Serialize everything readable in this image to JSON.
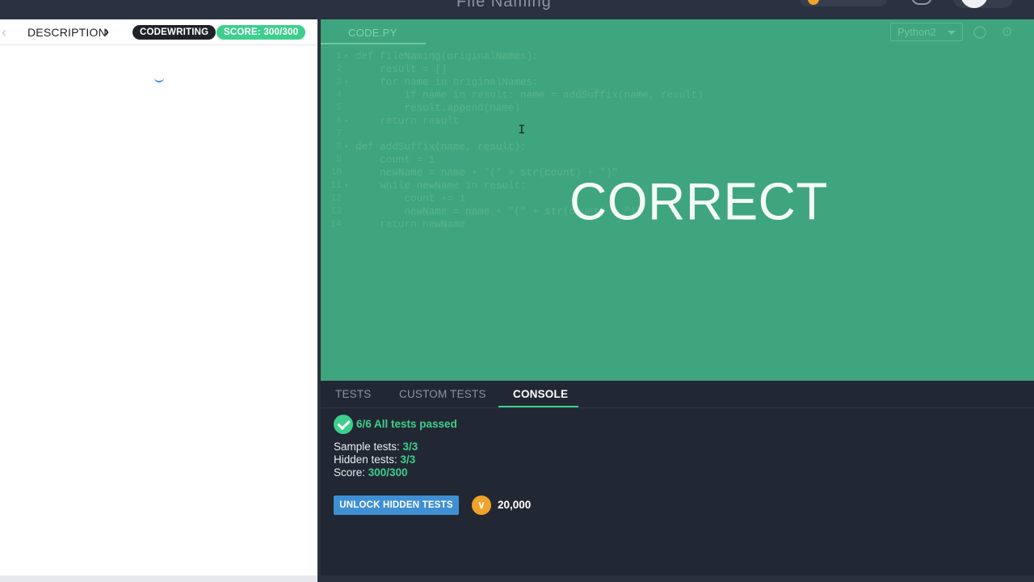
{
  "header": {
    "title": "File Naming"
  },
  "left_panel": {
    "description_label": "DESCRIPTION",
    "category_badge": "CODEWRITING",
    "score_badge": "SCORE: 300/300"
  },
  "editor": {
    "file_tab": "CODE.PY",
    "language": "Python2",
    "result_text": "CORRECT",
    "code_lines": [
      {
        "n": "1",
        "fold": true,
        "text": "def fileNaming(originalNames):"
      },
      {
        "n": "2",
        "fold": false,
        "text": "    result = []"
      },
      {
        "n": "3",
        "fold": true,
        "text": "    for name in originalNames:"
      },
      {
        "n": "4",
        "fold": false,
        "text": "        if name in result: name = addSuffix(name, result)"
      },
      {
        "n": "5",
        "fold": false,
        "text": "        result.append(name)"
      },
      {
        "n": "6",
        "fold": true,
        "text": "    return result"
      },
      {
        "n": "7",
        "fold": false,
        "text": ""
      },
      {
        "n": "8",
        "fold": true,
        "text": "def addSuffix(name, result):"
      },
      {
        "n": "9",
        "fold": false,
        "text": "    count = 1"
      },
      {
        "n": "10",
        "fold": false,
        "text": "    newName = name + \"(\" + str(count) + \")\""
      },
      {
        "n": "11",
        "fold": true,
        "text": "    while newName in result:"
      },
      {
        "n": "12",
        "fold": false,
        "text": "        count += 1"
      },
      {
        "n": "13",
        "fold": false,
        "text": "        newName = name + \"(\" + str(count) + \")\""
      },
      {
        "n": "14",
        "fold": false,
        "text": "    return newName"
      }
    ]
  },
  "bottom_panel": {
    "tabs": [
      {
        "label": "TESTS",
        "active": false
      },
      {
        "label": "CUSTOM TESTS",
        "active": false
      },
      {
        "label": "CONSOLE",
        "active": true
      }
    ],
    "summary": "6/6 All tests passed",
    "sample_label": "Sample tests: ",
    "sample_value": "3/3",
    "hidden_label": "Hidden tests: ",
    "hidden_value": "3/3",
    "score_label": "Score: ",
    "score_value": "300/300",
    "unlock_button": "UNLOCK HIDDEN TESTS",
    "coin_amount": "20,000"
  },
  "colors": {
    "accent_green": "#3ecf8e",
    "editor_bg": "#3fa57e",
    "button_blue": "#3f8fd3",
    "coin_orange": "#f1a22b"
  }
}
